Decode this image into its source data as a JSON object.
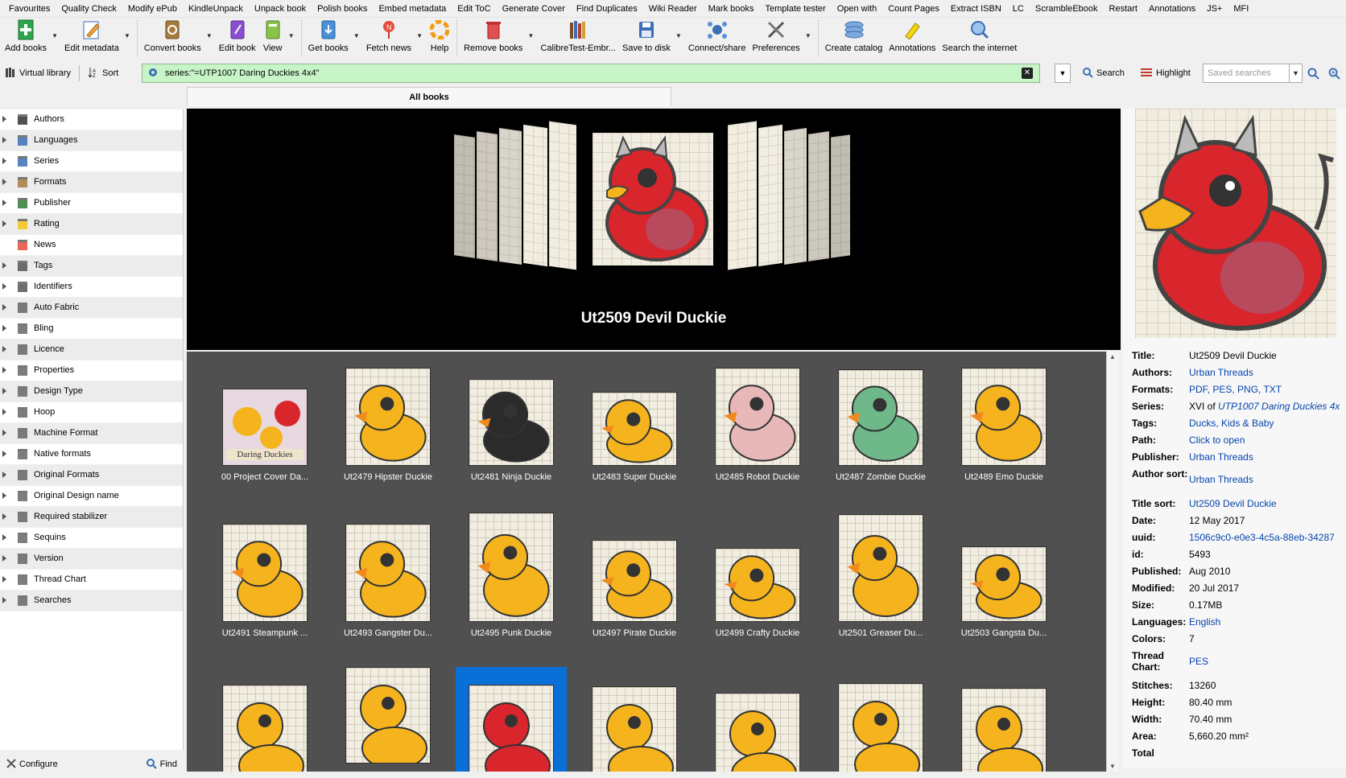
{
  "menu": [
    "Favourites",
    "Quality Check",
    "Modify ePub",
    "KindleUnpack",
    "Unpack book",
    "Polish books",
    "Embed metadata",
    "Edit ToC",
    "Generate Cover",
    "Find Duplicates",
    "Wiki Reader",
    "Mark books",
    "Template tester",
    "Open with",
    "Count Pages",
    "Extract ISBN",
    "LC",
    "ScrambleEbook",
    "Restart",
    "Annotations",
    "JS+",
    "MFI"
  ],
  "toolbar": {
    "add_books": "Add books",
    "edit_metadata": "Edit metadata",
    "convert_books": "Convert books",
    "edit_book": "Edit book",
    "view": "View",
    "get_books": "Get books",
    "fetch_news": "Fetch news",
    "help": "Help",
    "remove_books": "Remove books",
    "library": "CalibreTest-Embr...",
    "save_to_disk": "Save to disk",
    "connect_share": "Connect/share",
    "preferences": "Preferences",
    "create_catalog": "Create catalog",
    "annotations": "Annotations",
    "search_internet": "Search the internet"
  },
  "searchbar": {
    "virtual_library": "Virtual library",
    "sort": "Sort",
    "query": "series:\"=UTP1007 Daring Duckies 4x4\"",
    "search": "Search",
    "highlight": "Highlight",
    "saved_searches_placeholder": "Saved searches"
  },
  "tab": "All books",
  "sidebar": {
    "items": [
      "Authors",
      "Languages",
      "Series",
      "Formats",
      "Publisher",
      "Rating",
      "News",
      "Tags",
      "Identifiers",
      "Auto Fabric",
      "Bling",
      "Licence",
      "Properties",
      "Design Type",
      "Hoop",
      "Machine Format",
      "Native formats",
      "Original Formats",
      "Original Design name",
      "Required stabilizer",
      "Sequins",
      "Version",
      "Thread Chart",
      "Searches"
    ],
    "configure": "Configure",
    "find": "Find"
  },
  "coverflow": {
    "current_title": "Ut2509 Devil Duckie"
  },
  "grid": {
    "row1": [
      "00 Project Cover Da...",
      "Ut2479 Hipster Duckie",
      "Ut2481 Ninja Duckie",
      "Ut2483 Super Duckie",
      "Ut2485 Robot Duckie",
      "Ut2487 Zombie Duckie",
      "Ut2489 Emo Duckie"
    ],
    "row2": [
      "Ut2491 Steampunk ...",
      "Ut2493 Gangster Du...",
      "Ut2495 Punk Duckie",
      "Ut2497 Pirate Duckie",
      "Ut2499 Crafty Duckie",
      "Ut2501 Greaser Du...",
      "Ut2503 Gangsta Du..."
    ],
    "cover_text": "Daring Duckies"
  },
  "details": {
    "title_k": "Title:",
    "title_v": "Ut2509 Devil Duckie",
    "authors_k": "Authors:",
    "authors_v": "Urban Threads",
    "formats_k": "Formats:",
    "formats_v": "PDF, PES, PNG, TXT",
    "series_k": "Series:",
    "series_prefix": "XVI of ",
    "series_v": "UTP1007 Daring Duckies 4x",
    "tags_k": "Tags:",
    "tags_v": "Ducks, Kids & Baby",
    "path_k": "Path:",
    "path_v": "Click to open",
    "publisher_k": "Publisher:",
    "publisher_v": "Urban Threads",
    "author_sort_k": "Author sort:",
    "author_sort_v": "Urban Threads",
    "title_sort_k": "Title sort:",
    "title_sort_v": "Ut2509 Devil Duckie",
    "date_k": "Date:",
    "date_v": "12 May 2017",
    "uuid_k": "uuid:",
    "uuid_v": "1506c9c0-e0e3-4c5a-88eb-34287",
    "id_k": "id:",
    "id_v": "5493",
    "published_k": "Published:",
    "published_v": "Aug 2010",
    "modified_k": "Modified:",
    "modified_v": "20 Jul 2017",
    "size_k": "Size:",
    "size_v": "0.17MB",
    "languages_k": "Languages:",
    "languages_v": "English",
    "colors_k": "Colors:",
    "colors_v": "7",
    "thread_chart_k": "Thread Chart:",
    "thread_chart_v": "PES",
    "stitches_k": "Stitches:",
    "stitches_v": "13260",
    "height_k": "Height:",
    "height_v": "80.40 mm",
    "width_k": "Width:",
    "width_v": "70.40 mm",
    "area_k": "Area:",
    "area_v": "5,660.20 mm²",
    "total_k": "Total"
  }
}
